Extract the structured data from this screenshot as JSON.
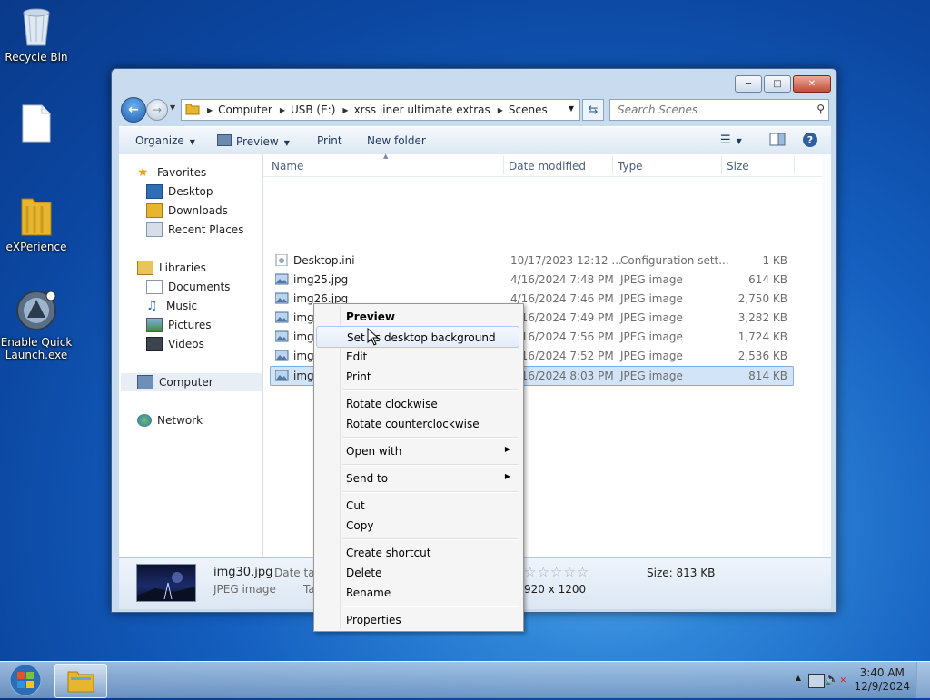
{
  "desktop": {
    "icons": [
      {
        "label": "Recycle Bin"
      },
      {
        "label": ""
      },
      {
        "label": "eXPerience"
      },
      {
        "label": "Enable Quick Launch.exe"
      }
    ]
  },
  "window": {
    "address": [
      "Computer",
      "USB (E:)",
      "xrss liner ultimate extras",
      "Scenes"
    ],
    "search_placeholder": "Search Scenes"
  },
  "toolbar": {
    "organize": "Organize",
    "preview": "Preview",
    "print": "Print",
    "new_folder": "New folder"
  },
  "nav_pane": {
    "favorites": "Favorites",
    "desktop": "Desktop",
    "downloads": "Downloads",
    "recent_places": "Recent Places",
    "libraries": "Libraries",
    "documents": "Documents",
    "music": "Music",
    "pictures": "Pictures",
    "videos": "Videos",
    "computer": "Computer",
    "network": "Network"
  },
  "columns": {
    "name": "Name",
    "date": "Date modified",
    "type": "Type",
    "size": "Size"
  },
  "files": [
    {
      "name": "Desktop.ini",
      "date": "10/17/2023 12:12 ...",
      "type": "Configuration sett...",
      "size": "1 KB"
    },
    {
      "name": "img25.jpg",
      "date": "4/16/2024 7:48 PM",
      "type": "JPEG image",
      "size": "614 KB"
    },
    {
      "name": "img26.jpg",
      "date": "4/16/2024 7:46 PM",
      "type": "JPEG image",
      "size": "2,750 KB"
    },
    {
      "name": "img27.jpg",
      "date": "4/16/2024 7:49 PM",
      "type": "JPEG image",
      "size": "3,282 KB"
    },
    {
      "name": "img28.jpg",
      "date": "4/16/2024 7:56 PM",
      "type": "JPEG image",
      "size": "1,724 KB"
    },
    {
      "name": "img29.jpg",
      "date": "4/16/2024 7:52 PM",
      "type": "JPEG image",
      "size": "2,536 KB"
    },
    {
      "name": "img30.jpg",
      "date": "4/16/2024 8:03 PM",
      "type": "JPEG image",
      "size": "814 KB"
    }
  ],
  "details": {
    "filename": "img30.jpg",
    "filetype": "JPEG image",
    "date_label": "Date tak",
    "tags_label": "Ta",
    "size": "Size: 813 KB",
    "dimensions": "920 x 1200",
    "rating": 0
  },
  "context_menu": {
    "preview": "Preview",
    "set_background": "Set as desktop background",
    "edit": "Edit",
    "print": "Print",
    "rotate_cw": "Rotate clockwise",
    "rotate_ccw": "Rotate counterclockwise",
    "open_with": "Open with",
    "send_to": "Send to",
    "cut": "Cut",
    "copy": "Copy",
    "create_shortcut": "Create shortcut",
    "delete": "Delete",
    "rename": "Rename",
    "properties": "Properties"
  },
  "taskbar": {
    "time": "3:40 AM",
    "date": "12/9/2024"
  }
}
